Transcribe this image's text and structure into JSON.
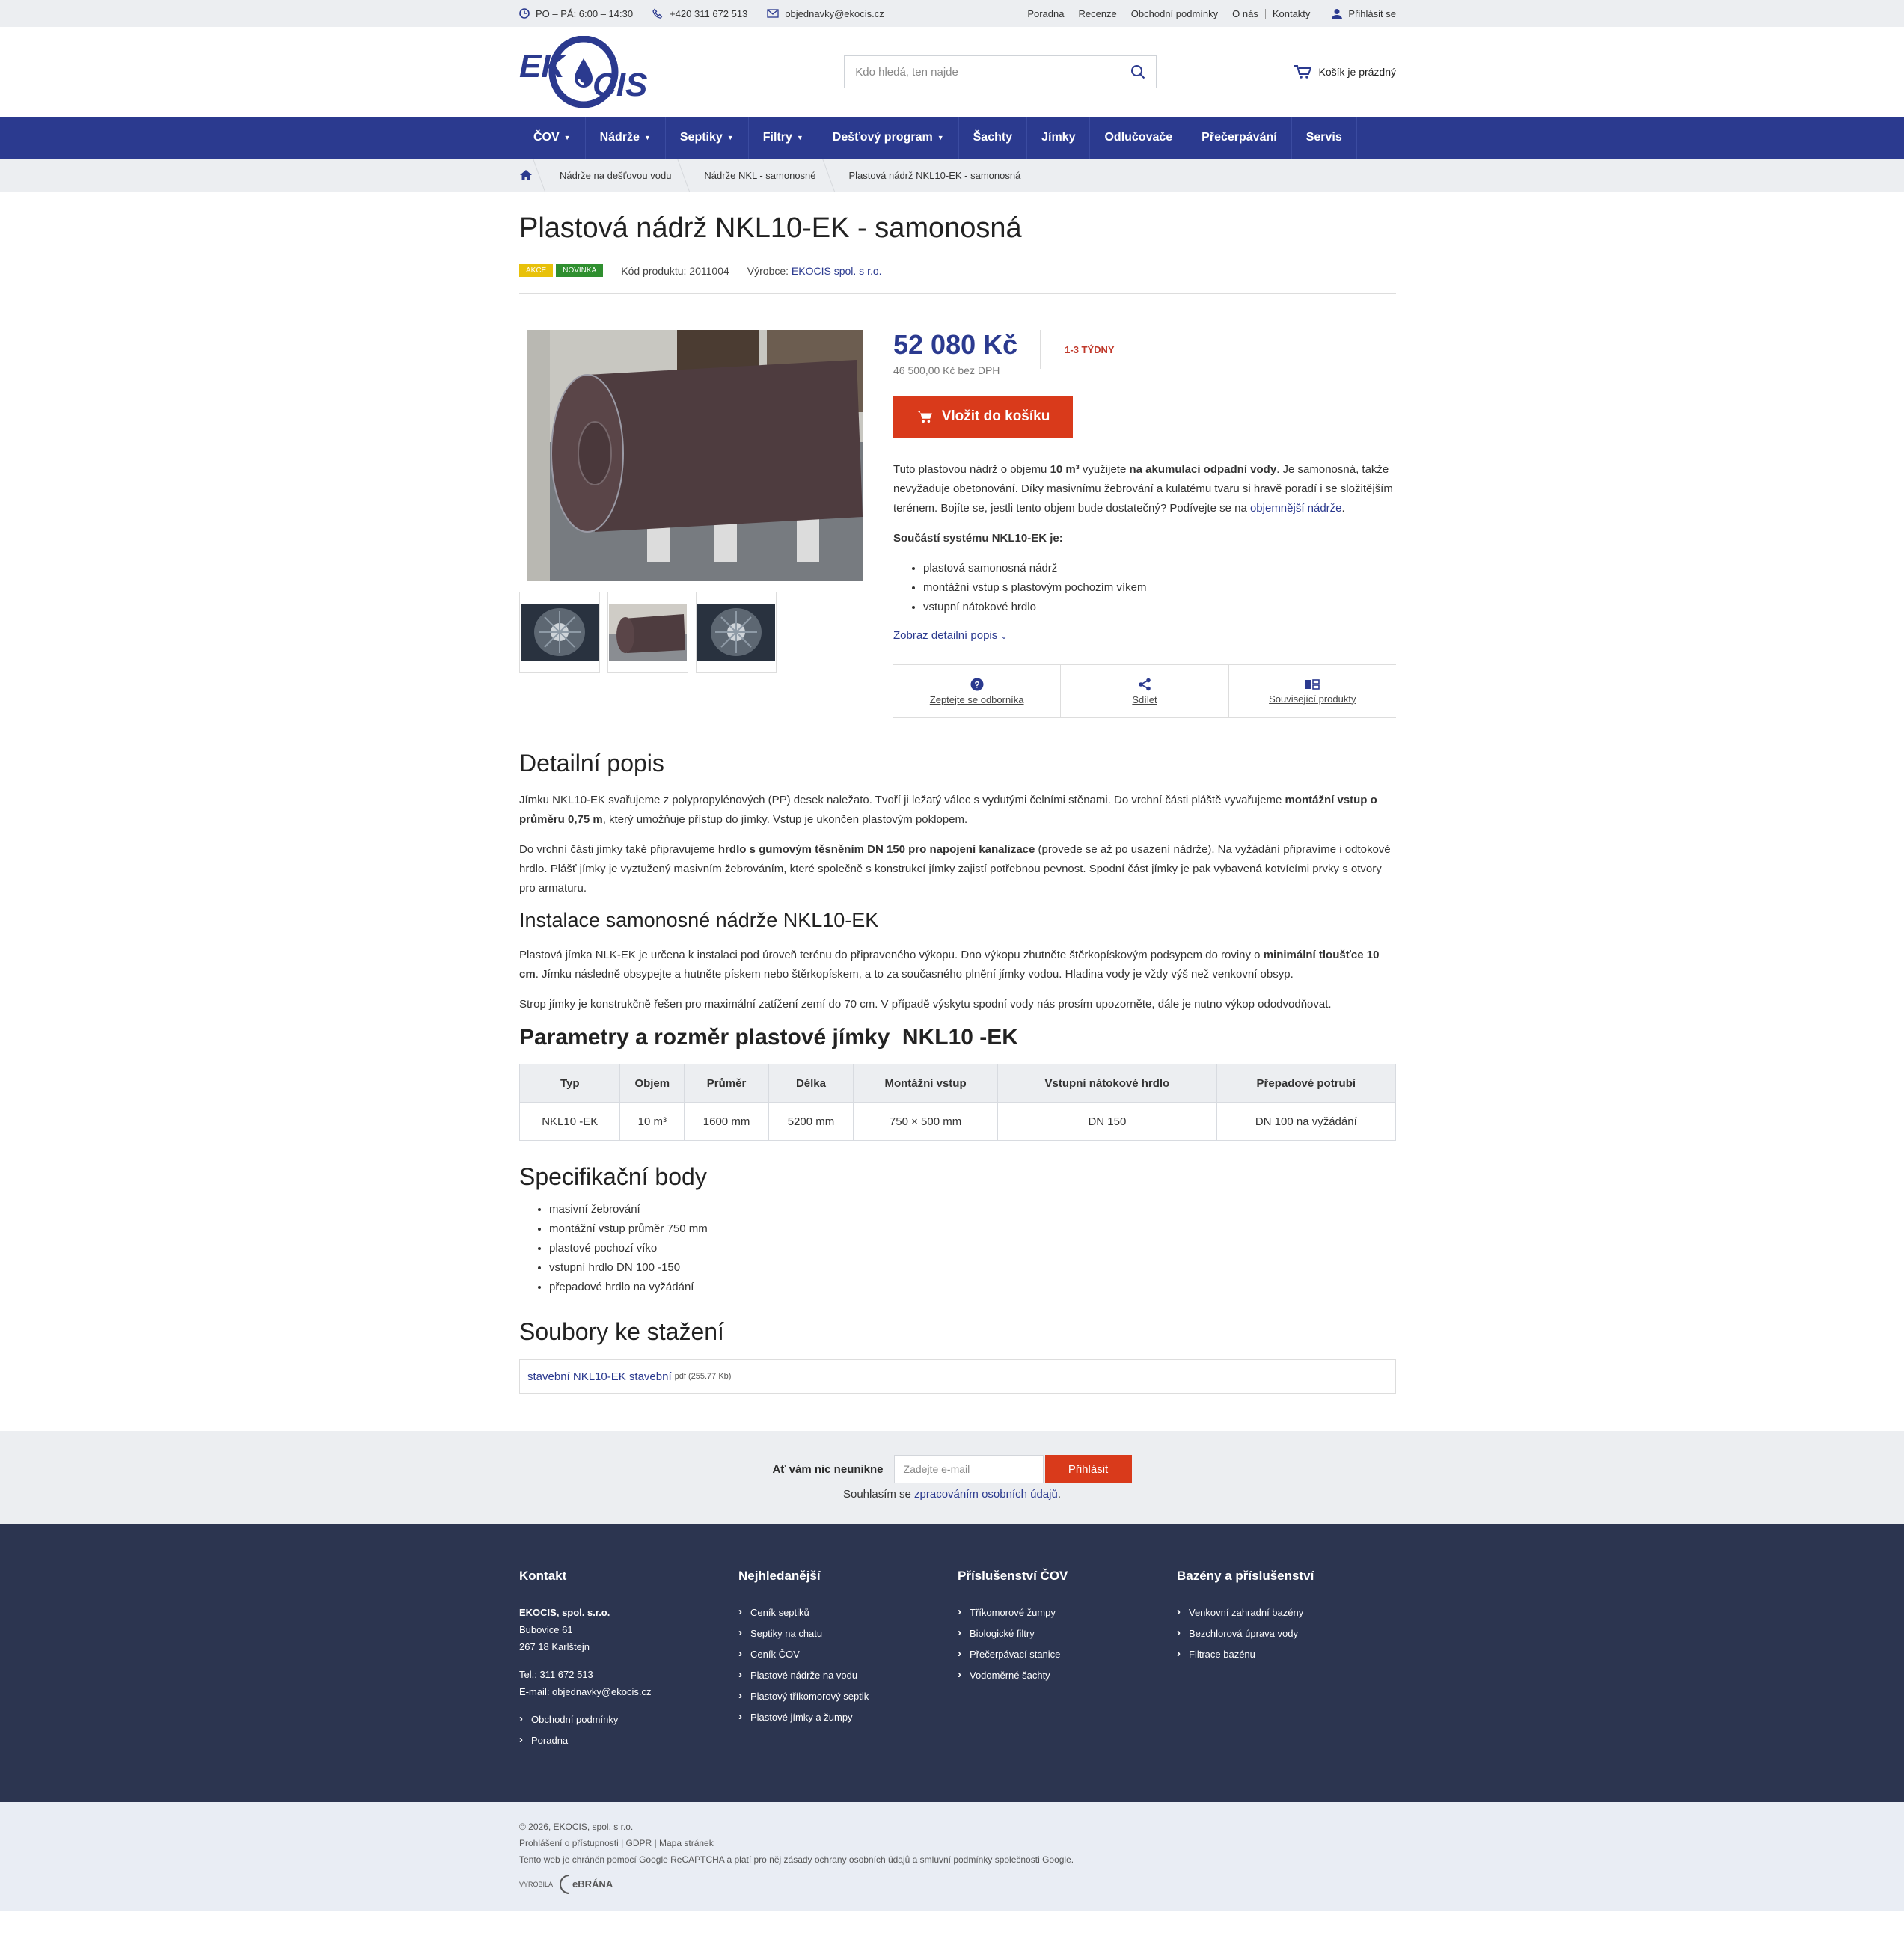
{
  "topbar": {
    "hours": "PO – PÁ: 6:00 – 14:30",
    "phone": "+420 311 672 513",
    "email": "objednavky@ekocis.cz",
    "links": [
      "Poradna",
      "Recenze",
      "Obchodní podmínky",
      "O nás",
      "Kontakty"
    ],
    "login": "Přihlásit se"
  },
  "header": {
    "logo_text": "EKOCIS",
    "search_placeholder": "Kdo hledá, ten najde",
    "cart": "Košík je prázdný"
  },
  "nav": {
    "items": [
      {
        "label": "ČOV",
        "dropdown": true
      },
      {
        "label": "Nádrže",
        "dropdown": true
      },
      {
        "label": "Septiky",
        "dropdown": true
      },
      {
        "label": "Filtry",
        "dropdown": true
      },
      {
        "label": "Dešťový program",
        "dropdown": true
      },
      {
        "label": "Šachty",
        "dropdown": false
      },
      {
        "label": "Jímky",
        "dropdown": false
      },
      {
        "label": "Odlučovače",
        "dropdown": false
      },
      {
        "label": "Přečerpávání",
        "dropdown": false
      },
      {
        "label": "Servis",
        "dropdown": false
      }
    ]
  },
  "breadcrumb": [
    "Nádrže na dešťovou vodu",
    "Nádrže NKL - samonosné",
    "Plastová nádrž NKL10-EK - samonosná"
  ],
  "product": {
    "title": "Plastová nádrž NKL10-EK - samonosná",
    "badges": [
      "AKCE",
      "NOVINKA"
    ],
    "code_label": "Kód produktu: 2011004",
    "maker_label": "Výrobce:",
    "maker": "EKOCIS spol. s r.o.",
    "price": "52 080 Kč",
    "price_novat": "46 500,00 Kč bez DPH",
    "availability": "1-3 TÝDNY",
    "buy_label": "Vložit do košíku",
    "desc_p1_a": "Tuto plastovou nádrž o objemu ",
    "desc_p1_b": "10 m³",
    "desc_p1_c": " využijete ",
    "desc_p1_d": "na akumulaci odpadní vody",
    "desc_p1_e": ". Je samonosná, takže nevyžaduje obetonování. Díky masivnímu žebrování a kulatému tvaru si hravě poradí i se složitějším terénem. Bojíte se, jestli tento objem bude dostatečný? Podívejte se na ",
    "desc_p1_link": "objemnější nádrže",
    "desc_p1_end": ".",
    "system_title": "Součástí systému NKL10-EK je:",
    "system_items": [
      "plastová samonosná nádrž",
      "montážní vstup s plastovým pochozím víkem",
      "vstupní nátokové hrdlo"
    ],
    "more_label": "Zobraz detailní popis",
    "actions": [
      "Zeptejte se odborníka",
      "Sdílet",
      "Související produkty"
    ]
  },
  "detail": {
    "title": "Detailní popis",
    "p1_a": "Jímku NKL10-EK svařujeme z polypropylénových (PP) desek naležato. Tvoří ji ležatý válec s vydutými čelními stěnami. Do vrchní části pláště vyvařujeme ",
    "p1_b": "montážní vstup o průměru 0,75 m",
    "p1_c": ", který umožňuje přístup do jímky. Vstup je ukončen plastovým poklopem.",
    "p2_a": "Do vrchní části jímky také připravujeme ",
    "p2_b": "hrdlo s gumovým těsněním DN 150 pro napojení kanalizace",
    "p2_c": " (provede se až po usazení nádrže). Na vyžádání připravíme i odtokové hrdlo. Plášť jímky je vyztužený masivním žebrováním, které společně s konstrukcí jímky zajistí potřebnou pevnost. Spodní část jímky je pak vybavená kotvícími prvky s otvory pro armaturu."
  },
  "install": {
    "title": "Instalace samonosné nádrže NKL10-EK",
    "p1_a": "Plastová jímka NLK-EK je určena k instalaci pod úroveň terénu do připraveného výkopu. Dno výkopu zhutněte štěrkopískovým podsypem do roviny o ",
    "p1_b": "minimální tloušťce 10 cm",
    "p1_c": ". Jímku následně obsypejte a hutněte pískem nebo štěrkopískem, a to za současného plnění jímky vodou. Hladina vody je vždy výš než venkovní obsyp.",
    "p2": "Strop jímky je konstrukčně řešen pro maximální zatížení zemí do 70 cm. V případě výskytu spodní vody nás prosím upozorněte, dále je nutno výkop ododvodňovat."
  },
  "params": {
    "title": "Parametry a rozměr plastové jímky  NKL10 -EK",
    "headers": [
      "Typ",
      "Objem",
      "Průměr",
      "Délka",
      "Montážní vstup",
      "Vstupní nátokové hrdlo",
      "Přepadové potrubí"
    ],
    "row": [
      "NKL10 -EK",
      "10 m³",
      "1600 mm",
      "5200 mm",
      "750 × 500 mm",
      "DN 150",
      "DN 100 na vyžádání"
    ]
  },
  "spec": {
    "title": "Specifikační body",
    "items": [
      "masivní žebrování",
      "montážní vstup průměr 750 mm",
      "plastové pochozí víko",
      "vstupní hrdlo DN 100 -150",
      "přepadové hrdlo na vyžádání"
    ]
  },
  "files": {
    "title": "Soubory ke stažení",
    "name": "stavební NKL10-EK stavební",
    "meta": "pdf (255.77 Kb)"
  },
  "newsletter": {
    "label": "Ať vám nic neunikne",
    "placeholder": "Zadejte e-mail",
    "button": "Přihlásit",
    "consent_a": "Souhlasím se ",
    "consent_link": "zpracováním osobních údajů",
    "consent_end": "."
  },
  "footer": {
    "col1": {
      "title": "Kontakt",
      "company": "EKOCIS, spol. s.r.o.",
      "addr1": "Bubovice 61",
      "addr2": "267 18 Karlštejn",
      "tel": "Tel.: 311 672 513",
      "email": "E-mail: objednavky@ekocis.cz",
      "links": [
        "Obchodní podmínky",
        "Poradna"
      ]
    },
    "col2": {
      "title": "Nejhledanější",
      "links": [
        "Ceník septiků",
        "Septiky na chatu",
        "Ceník ČOV",
        "Plastové nádrže na vodu",
        "Plastový tříkomorový septik",
        "Plastové jímky a žumpy"
      ]
    },
    "col3": {
      "title": "Příslušenství ČOV",
      "links": [
        "Tříkomorové žumpy",
        "Biologické filtry",
        "Přečerpávací stanice",
        "Vodoměrné šachty"
      ]
    },
    "col4": {
      "title": "Bazény a příslušenství",
      "links": [
        "Venkovní zahradní bazény",
        "Bezchlorová úprava vody",
        "Filtrace bazénu"
      ]
    }
  },
  "bottom": {
    "copyright": "© 2026, EKOCIS, spol. s r.o.",
    "links": [
      "Prohlášení o přístupnosti",
      "GDPR",
      "Mapa stránek"
    ],
    "recaptcha_a": "Tento web je chráněn pomocí Google ReCAPTCHA a platí pro něj ",
    "recaptcha_l1": "zásady ochrany osobních údajů",
    "recaptcha_b": " a ",
    "recaptcha_l2": "smluvní podmínky",
    "recaptcha_c": " společnosti Google.",
    "made_by": "VYROBILA",
    "brana": "eBRÁNA"
  },
  "colors": {
    "brand": "#2b3a8f",
    "accent": "#d93a1b",
    "footer": "#2c3550"
  }
}
